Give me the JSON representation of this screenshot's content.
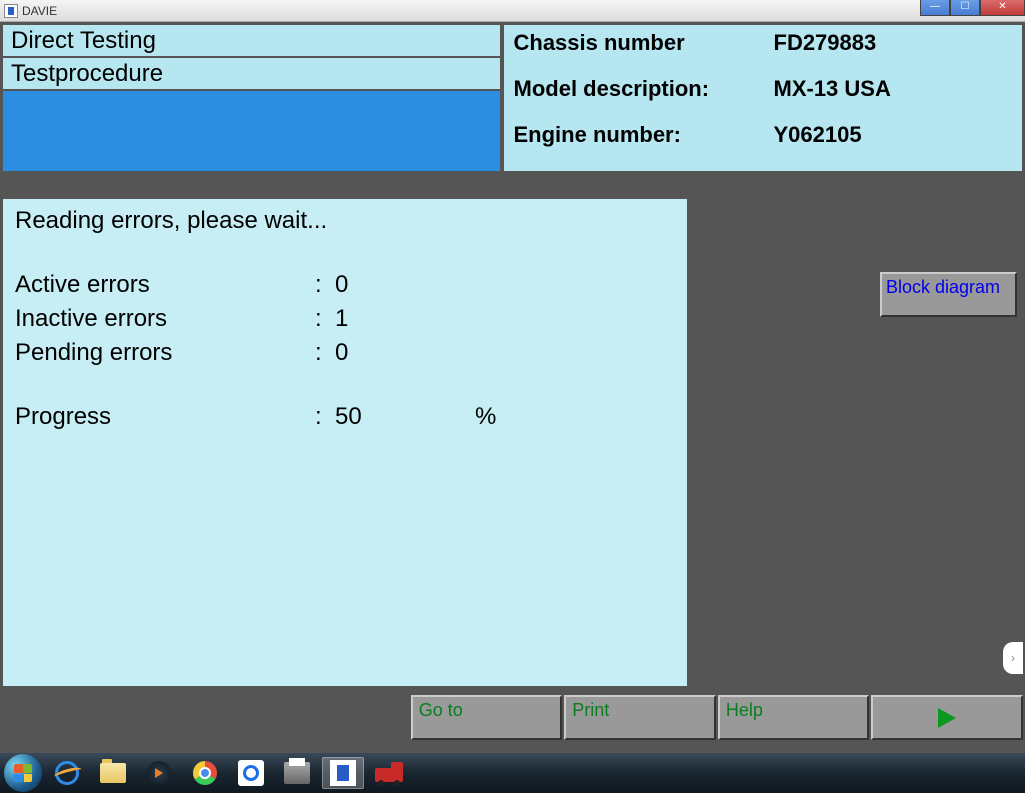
{
  "window": {
    "title": "DAVIE"
  },
  "left": {
    "row1": "Direct Testing",
    "row2": "Testprocedure"
  },
  "info": {
    "chassis_label": "Chassis number",
    "chassis_value": "FD279883",
    "model_label": "Model description:",
    "model_value": "MX-13 USA",
    "engine_label": "Engine number:",
    "engine_value": "Y062105"
  },
  "status": {
    "heading": "Reading errors, please wait...",
    "active_label": "Active errors",
    "active_value": "0",
    "inactive_label": "Inactive errors",
    "inactive_value": "1",
    "pending_label": "Pending errors",
    "pending_value": "0",
    "progress_label": "Progress",
    "progress_value": "50",
    "progress_unit": "%"
  },
  "buttons": {
    "block_diagram": "Block diagram",
    "goto": "Go to",
    "print": "Print",
    "help": "Help"
  }
}
